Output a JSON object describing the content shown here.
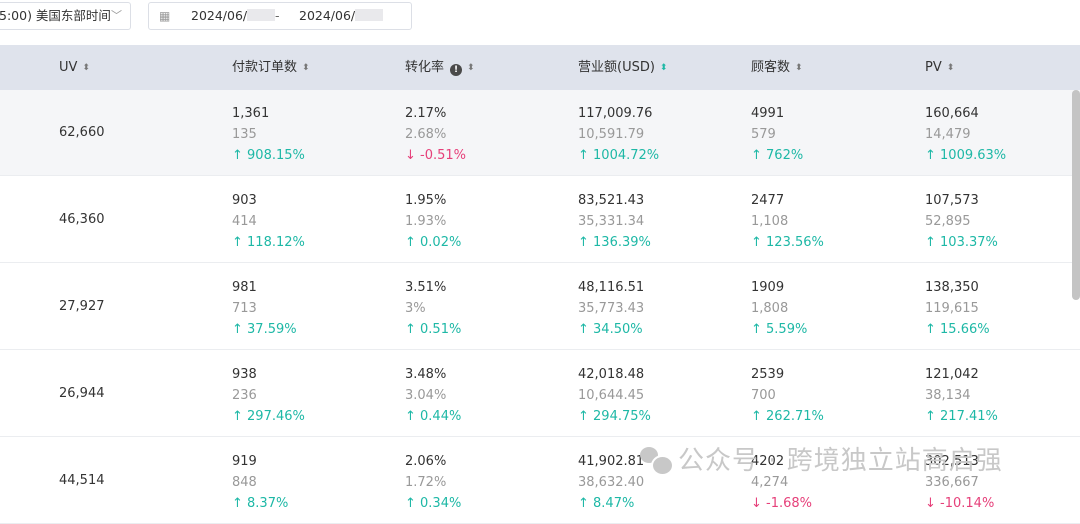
{
  "toolbar": {
    "timezone": "5:00) 美国东部时间",
    "date_start": "2024/06/",
    "date_separator": "-",
    "date_end": "2024/06/"
  },
  "columns": [
    {
      "label": "UV"
    },
    {
      "label": "付款订单数"
    },
    {
      "label": "转化率",
      "has_info": true
    },
    {
      "label": "营业额(USD)",
      "sorted": true
    },
    {
      "label": "顾客数"
    },
    {
      "label": "PV"
    }
  ],
  "rows": [
    {
      "uv": "62,660",
      "highlighted": true,
      "cells": [
        {
          "cur": "1,361",
          "prev": "135",
          "change": "908.15%",
          "dir": "up"
        },
        {
          "cur": "2.17%",
          "prev": "2.68%",
          "change": "-0.51%",
          "dir": "down"
        },
        {
          "cur": "117,009.76",
          "prev": "10,591.79",
          "change": "1004.72%",
          "dir": "up"
        },
        {
          "cur": "4991",
          "prev": "579",
          "change": "762%",
          "dir": "up"
        },
        {
          "cur": "160,664",
          "prev": "14,479",
          "change": "1009.63%",
          "dir": "up"
        }
      ]
    },
    {
      "uv": "46,360",
      "cells": [
        {
          "cur": "903",
          "prev": "414",
          "change": "118.12%",
          "dir": "up"
        },
        {
          "cur": "1.95%",
          "prev": "1.93%",
          "change": "0.02%",
          "dir": "up"
        },
        {
          "cur": "83,521.43",
          "prev": "35,331.34",
          "change": "136.39%",
          "dir": "up"
        },
        {
          "cur": "2477",
          "prev": "1,108",
          "change": "123.56%",
          "dir": "up"
        },
        {
          "cur": "107,573",
          "prev": "52,895",
          "change": "103.37%",
          "dir": "up"
        }
      ]
    },
    {
      "uv": "27,927",
      "cells": [
        {
          "cur": "981",
          "prev": "713",
          "change": "37.59%",
          "dir": "up"
        },
        {
          "cur": "3.51%",
          "prev": "3%",
          "change": "0.51%",
          "dir": "up"
        },
        {
          "cur": "48,116.51",
          "prev": "35,773.43",
          "change": "34.50%",
          "dir": "up"
        },
        {
          "cur": "1909",
          "prev": "1,808",
          "change": "5.59%",
          "dir": "up"
        },
        {
          "cur": "138,350",
          "prev": "119,615",
          "change": "15.66%",
          "dir": "up"
        }
      ]
    },
    {
      "uv": "26,944",
      "cells": [
        {
          "cur": "938",
          "prev": "236",
          "change": "297.46%",
          "dir": "up"
        },
        {
          "cur": "3.48%",
          "prev": "3.04%",
          "change": "0.44%",
          "dir": "up"
        },
        {
          "cur": "42,018.48",
          "prev": "10,644.45",
          "change": "294.75%",
          "dir": "up"
        },
        {
          "cur": "2539",
          "prev": "700",
          "change": "262.71%",
          "dir": "up"
        },
        {
          "cur": "121,042",
          "prev": "38,134",
          "change": "217.41%",
          "dir": "up"
        }
      ]
    },
    {
      "uv": "44,514",
      "cells": [
        {
          "cur": "919",
          "prev": "848",
          "change": "8.37%",
          "dir": "up"
        },
        {
          "cur": "2.06%",
          "prev": "1.72%",
          "change": "0.34%",
          "dir": "up"
        },
        {
          "cur": "41,902.81",
          "prev": "38,632.40",
          "change": "8.47%",
          "dir": "up"
        },
        {
          "cur": "4202",
          "prev": "4,274",
          "change": "-1.68%",
          "dir": "down"
        },
        {
          "cur": "302,513",
          "prev": "336,667",
          "change": "-10.14%",
          "dir": "down"
        }
      ]
    }
  ],
  "watermark": "公众号 · 跨境独立站高启强",
  "colors": {
    "up": "#1eb8a6",
    "down": "#e6407a",
    "header_bg": "#dfe3ec"
  }
}
